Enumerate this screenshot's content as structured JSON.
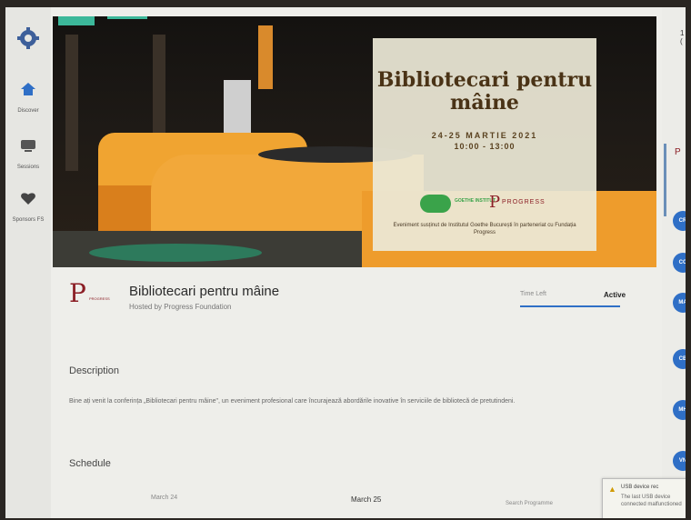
{
  "rail": {
    "items": [
      {
        "label": "Discover",
        "icon": "home-icon"
      },
      {
        "label": "Sessions",
        "icon": "tv-icon"
      },
      {
        "label": "Sponsors FS",
        "icon": "heart-icon"
      }
    ]
  },
  "banner": {
    "title": "Bibliotecari pentru mâine",
    "dates": "24-25 MARTIE 2021",
    "hours": "10:00 - 13:00",
    "goethe_logo": "GOETHE INSTITUT",
    "progress_logo": "PROGRESS",
    "footer": "Eveniment susținut de Institutul Goethe București în parteneriat cu Fundația Progress"
  },
  "event": {
    "title": "Bibliotecari pentru mâine",
    "hosted_by": "Hosted by Progress Foundation"
  },
  "tabs": {
    "all": "Time Left",
    "active": "Active"
  },
  "description": {
    "heading": "Description",
    "text": "Bine ați venit la conferința „Bibliotecari pentru mâine\", un eveniment profesional care încurajează abordările inovative în serviciile de bibliotecă de pretutindeni."
  },
  "schedule": {
    "heading": "Schedule",
    "days": [
      "March 24",
      "March 25",
      "Search Programme"
    ]
  },
  "right_rail": {
    "top_label": "1 (",
    "avatars": [
      "CR",
      "CC",
      "MA",
      "CB",
      "MH",
      "VN"
    ]
  },
  "notice": {
    "title": "USB device rec",
    "text": "The last USB device connected malfunctioned"
  },
  "colors": {
    "accent": "#2f6fc6",
    "brand": "#8b1e25",
    "banner_orange": "#f0a431"
  }
}
